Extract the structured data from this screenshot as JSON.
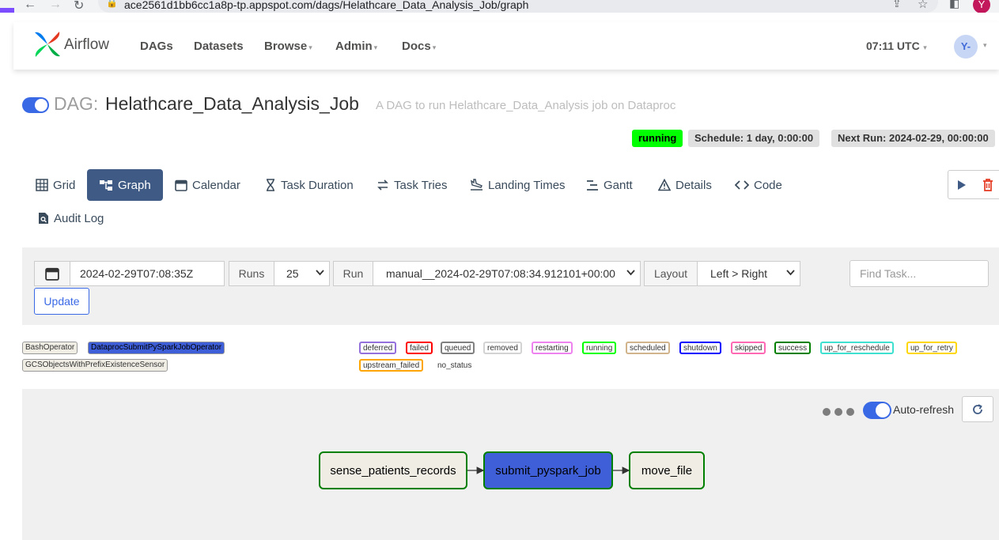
{
  "browser": {
    "url": "ace2561d1bb6cc1a8p-tp.appspot.com/dags/Helathcare_Data_Analysis_Job/graph",
    "profile_initial": "Y"
  },
  "navbar": {
    "brand": "Airflow",
    "items": [
      {
        "label": "DAGs",
        "dropdown": false
      },
      {
        "label": "Datasets",
        "dropdown": false
      },
      {
        "label": "Browse",
        "dropdown": true
      },
      {
        "label": "Admin",
        "dropdown": true
      },
      {
        "label": "Docs",
        "dropdown": true
      }
    ],
    "time": "07:11 UTC",
    "user": "Y-"
  },
  "dag": {
    "prefix": "DAG:",
    "name": "Helathcare_Data_Analysis_Job",
    "description": "A DAG to run Helathcare_Data_Analysis job on Dataproc",
    "paused": false,
    "state": "running",
    "schedule": "Schedule: 1 day, 0:00:00",
    "next_run": "Next Run: 2024-02-29, 00:00:00"
  },
  "tabs": [
    {
      "label": "Grid",
      "icon": "grid-icon"
    },
    {
      "label": "Graph",
      "icon": "graph-icon",
      "active": true
    },
    {
      "label": "Calendar",
      "icon": "calendar-icon"
    },
    {
      "label": "Task Duration",
      "icon": "hourglass-icon"
    },
    {
      "label": "Task Tries",
      "icon": "retry-icon"
    },
    {
      "label": "Landing Times",
      "icon": "plane-landing-icon"
    },
    {
      "label": "Gantt",
      "icon": "gantt-icon"
    },
    {
      "label": "Details",
      "icon": "warning-triangle-icon"
    },
    {
      "label": "Code",
      "icon": "code-icon"
    },
    {
      "label": "Audit Log",
      "icon": "audit-log-icon"
    }
  ],
  "controls": {
    "date": "2024-02-29T07:08:35Z",
    "runs_label": "Runs",
    "runs_value": "25",
    "run_label": "Run",
    "run_value": "manual__2024-02-29T07:08:34.912101+00:00",
    "layout_label": "Layout",
    "layout_value": "Left > Right",
    "find_placeholder": "Find Task...",
    "update_label": "Update"
  },
  "legend": {
    "operators": [
      {
        "label": "BashOperator",
        "color": "#f0ede4"
      },
      {
        "label": "DataprocSubmitPySparkJobOperator",
        "color": "#3f5fd8"
      },
      {
        "label": "GCSObjectsWithPrefixExistenceSensor",
        "color": "#f0ede4"
      }
    ],
    "states": [
      {
        "label": "deferred",
        "color": "#9370db"
      },
      {
        "label": "failed",
        "color": "#ff0000"
      },
      {
        "label": "queued",
        "color": "#808080"
      },
      {
        "label": "removed",
        "color": "#d3d3d3"
      },
      {
        "label": "restarting",
        "color": "#ee82ee"
      },
      {
        "label": "running",
        "color": "#00ff00"
      },
      {
        "label": "scheduled",
        "color": "#d2b48c"
      },
      {
        "label": "shutdown",
        "color": "#0000ff"
      },
      {
        "label": "skipped",
        "color": "#ff69b4"
      },
      {
        "label": "success",
        "color": "#008000"
      },
      {
        "label": "up_for_reschedule",
        "color": "#40e0d0"
      },
      {
        "label": "up_for_retry",
        "color": "#ffd700"
      },
      {
        "label": "upstream_failed",
        "color": "#ffa500"
      },
      {
        "label": "no_status",
        "color": "#ffffff"
      }
    ]
  },
  "graph": {
    "auto_refresh_label": "Auto-refresh",
    "auto_refresh_on": true,
    "nodes": [
      {
        "label": "sense_patients_records",
        "fill": "#f0ede4",
        "border": "#008000"
      },
      {
        "label": "submit_pyspark_job",
        "fill": "#3f5fd8",
        "border": "#008000"
      },
      {
        "label": "move_file",
        "fill": "#f0ede4",
        "border": "#008000"
      }
    ]
  }
}
